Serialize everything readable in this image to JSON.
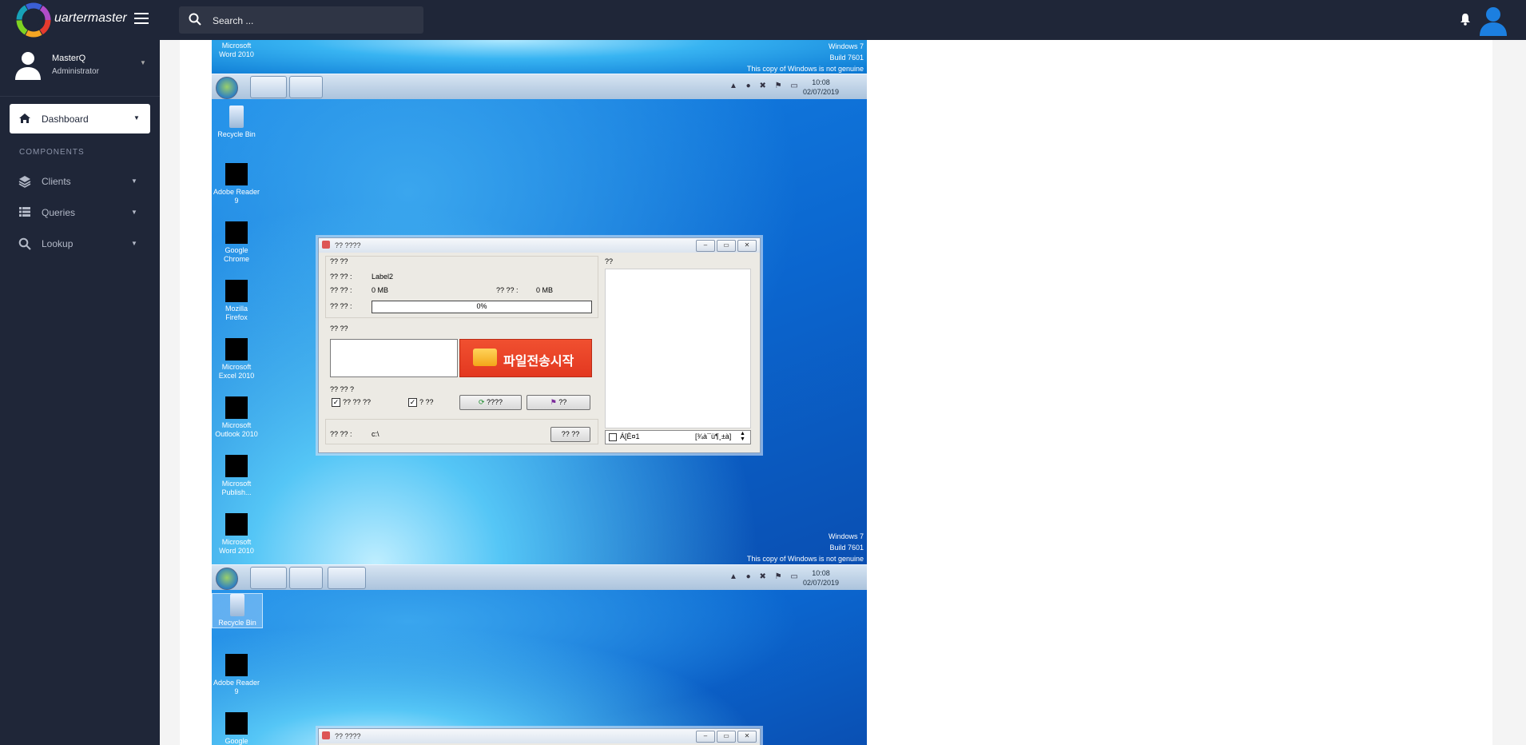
{
  "header": {
    "brand": "uartermaster",
    "search_placeholder": "Search ..."
  },
  "sidebar": {
    "user_name": "MasterQ",
    "user_role": "Administrator",
    "active_item": "Dashboard",
    "section_label": "COMPONENTS",
    "items": [
      {
        "label": "Clients",
        "icon": "layers-icon"
      },
      {
        "label": "Queries",
        "icon": "list-icon"
      },
      {
        "label": "Lookup",
        "icon": "search-icon"
      }
    ]
  },
  "colors": {
    "topbar": "#1f2638",
    "avatar_blue": "#1c7fe0",
    "send_button": "#e8401f"
  },
  "feed": {
    "top_strip": {
      "icon_label_1": "Microsoft",
      "icon_label_2": "Word 2010",
      "watermark_1": "Windows 7",
      "watermark_2": "Build 7601",
      "watermark_3": "This copy of Windows is not genuine",
      "clock_time": "10:08",
      "clock_date": "02/07/2019"
    },
    "screen1": {
      "icons": [
        {
          "line1": "Recycle Bin",
          "line2": ""
        },
        {
          "line1": "Adobe Reader",
          "line2": "9"
        },
        {
          "line1": "Google",
          "line2": "Chrome"
        },
        {
          "line1": "Mozilla",
          "line2": "Firefox"
        },
        {
          "line1": "Microsoft",
          "line2": "Excel 2010"
        },
        {
          "line1": "Microsoft",
          "line2": "Outlook 2010"
        },
        {
          "line1": "Microsoft",
          "line2": "Publish..."
        },
        {
          "line1": "Microsoft",
          "line2": "Word 2010"
        }
      ],
      "watermark_1": "Windows 7",
      "watermark_2": "Build 7601",
      "watermark_3": "This copy of Windows is not genuine",
      "clock_time": "10:08",
      "clock_date": "02/07/2019"
    },
    "window": {
      "title": "?? ????",
      "group1": "?? ??",
      "row1_label": "?? ?? :",
      "row1_value": "Label2",
      "row2_label": "?? ?? :",
      "row2_value": "0 MB",
      "row2b_label": "?? ?? :",
      "row2b_value": "0 MB",
      "row3_label": "?? ?? :",
      "progress": "0%",
      "group2": "?? ??",
      "send_label": "파일전송시작",
      "group3": "?? ?? ?",
      "check1": "?? ?? ??",
      "check2": "? ??",
      "refresh_label": "????",
      "other_label": "??",
      "path_label": "?? ?? :",
      "path_value": "c:\\",
      "browse_label": "?? ??",
      "right_group": "??",
      "spin_left": "Á[È¤1",
      "spin_right": "[¾à¯ü¶¸±à]"
    },
    "screen2": {
      "icons": [
        {
          "line1": "Recycle Bin",
          "line2": ""
        },
        {
          "line1": "Adobe Reader",
          "line2": "9"
        },
        {
          "line1": "Google",
          "line2": ""
        }
      ],
      "window_title": "?? ????",
      "clock_time": "10:08",
      "clock_date": "02/07/2019"
    }
  }
}
